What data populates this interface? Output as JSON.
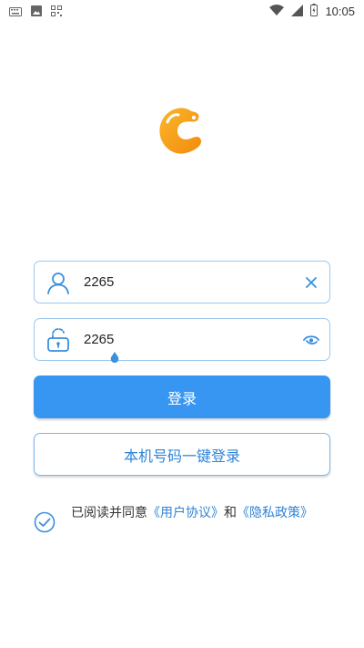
{
  "status_bar": {
    "time": "10:05",
    "left_icons": [
      "keyboard-icon",
      "image-icon",
      "qr-code-icon"
    ],
    "right_icons": [
      "wifi-icon",
      "signal-icon",
      "battery-icon"
    ]
  },
  "app": {
    "logo_icon": "app-logo-icon",
    "brand_color": "#F7A11A"
  },
  "login_form": {
    "username": {
      "value": "2265",
      "icon": "user-icon",
      "action_icon": "clear-icon"
    },
    "password": {
      "value": "2265",
      "icon": "lock-icon",
      "action_icon": "eye-icon"
    },
    "login_button": "登录",
    "phone_login_button": "本机号码一键登录"
  },
  "agreement": {
    "prefix": "已阅读并同意",
    "user_agreement": "《用户协议》",
    "conjunction": "和",
    "privacy_policy": "《隐私政策》",
    "checked": true
  },
  "colors": {
    "accent": "#3896F3",
    "border": "#9CC7EF",
    "link": "#2F84D6"
  }
}
